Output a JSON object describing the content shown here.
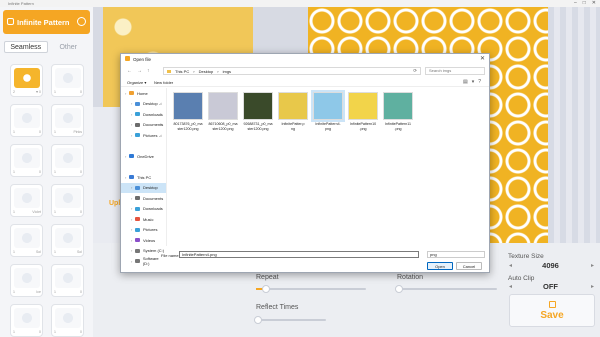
{
  "window": {
    "title": "Infinite Pattern",
    "controls": [
      "–",
      "□",
      "✕"
    ]
  },
  "app": {
    "name": "Infinite Pattern",
    "modes": [
      {
        "label": "Seamless",
        "active": true
      },
      {
        "label": "Other",
        "active": false
      }
    ],
    "upload_label": "Upl",
    "thumbnails": [
      {
        "left": "2",
        "right": "♥ 0",
        "selected": true
      },
      {
        "left": "1",
        "right": "0",
        "selected": false
      },
      {
        "left": "1",
        "right": "0",
        "selected": false
      },
      {
        "left": "1",
        "right": "Pinks",
        "selected": false
      },
      {
        "left": "1",
        "right": "0",
        "selected": false
      },
      {
        "left": "1",
        "right": "0",
        "selected": false
      },
      {
        "left": "1",
        "right": "Violet",
        "selected": false
      },
      {
        "left": "1",
        "right": "0",
        "selected": false
      },
      {
        "left": "1",
        "right": "Sol",
        "selected": false
      },
      {
        "left": "1",
        "right": "Sol",
        "selected": false
      },
      {
        "left": "1",
        "right": "Ice",
        "selected": false
      },
      {
        "left": "1",
        "right": "0",
        "selected": false
      },
      {
        "left": "1",
        "right": "0",
        "selected": false
      },
      {
        "left": "1",
        "right": "0",
        "selected": false
      }
    ],
    "controls": {
      "repeat_label": "Repeat",
      "rotation_label": "Rotation",
      "reflect_label": "Reflect Times"
    },
    "right": {
      "texture_size_label": "Texture Size",
      "texture_size_value": "4096",
      "auto_clip_label": "Auto Clip",
      "auto_clip_value": "OFF",
      "save_label": "Save"
    }
  },
  "dialog": {
    "title": "Open file",
    "close": "✕",
    "nav": [
      "←",
      "→",
      "↑",
      "⟳"
    ],
    "breadcrumb": [
      "This PC",
      "Desktop",
      "imgs"
    ],
    "refresh": "⟳",
    "search_placeholder": "Search imgs",
    "toolbar": {
      "organize": "Organize ▾",
      "new_folder": "New folder",
      "view": [
        "▤",
        "▾",
        "?"
      ]
    },
    "nav_items": [
      {
        "label": "Home",
        "indent": false,
        "pin": false,
        "color": "#f0a030"
      },
      {
        "label": "Desktop",
        "indent": true,
        "pin": true,
        "color": "#4a8fd8"
      },
      {
        "label": "Downloads",
        "indent": true,
        "pin": true,
        "color": "#3aa0d8"
      },
      {
        "label": "Documents",
        "indent": true,
        "pin": true,
        "color": "#6c6c6c"
      },
      {
        "label": "Pictures",
        "indent": true,
        "pin": true,
        "color": "#3aa0d8"
      },
      {
        "label": "",
        "indent": false,
        "pin": false,
        "color": "transparent"
      },
      {
        "label": "OneDrive",
        "indent": false,
        "pin": false,
        "color": "#2f7ad6"
      },
      {
        "label": "",
        "indent": false,
        "pin": false,
        "color": "transparent"
      },
      {
        "label": "This PC",
        "indent": false,
        "pin": false,
        "color": "#3a7bd5"
      },
      {
        "label": "Desktop",
        "indent": true,
        "pin": false,
        "color": "#4a8fd8",
        "selected": true
      },
      {
        "label": "Documents",
        "indent": true,
        "pin": false,
        "color": "#6c6c6c"
      },
      {
        "label": "Downloads",
        "indent": true,
        "pin": false,
        "color": "#3aa0d8"
      },
      {
        "label": "Music",
        "indent": true,
        "pin": false,
        "color": "#e5533d"
      },
      {
        "label": "Pictures",
        "indent": true,
        "pin": false,
        "color": "#3aa0d8"
      },
      {
        "label": "Videos",
        "indent": true,
        "pin": false,
        "color": "#8a4fc9"
      },
      {
        "label": "System (C:)",
        "indent": true,
        "pin": false,
        "color": "#777"
      },
      {
        "label": "Software (D:)",
        "indent": true,
        "pin": false,
        "color": "#777"
      }
    ],
    "files": [
      {
        "name": "80173876_p0_master1200.png",
        "line1": "80173876_p0_ma",
        "line2": "ster1200.png",
        "color": "#5a7fb0",
        "selected": false
      },
      {
        "name": "86710608_p0_master1200.png",
        "line1": "86710608_p0_ma",
        "line2": "ster1200.png",
        "color": "#c9c9d6",
        "selected": false
      },
      {
        "name": "92688731_p0_master1200.png",
        "line1": "92688731_p0_ma",
        "line2": "ster1200.png",
        "color": "#3a4a2a",
        "selected": false
      },
      {
        "name": "InfinitePattern.png",
        "line1": "InfinitePatter.p",
        "line2": "ng",
        "color": "#e8c84a",
        "selected": false
      },
      {
        "name": "InfinitePattern4.png",
        "line1": "InfinitePattern4.",
        "line2": "png",
        "color": "#8ec8e8",
        "selected": true
      },
      {
        "name": "InfinitePattern10.png",
        "line1": "InfinitePattern10",
        "line2": ".png",
        "color": "#f2d44a",
        "selected": false
      },
      {
        "name": "InfinitePattern11.png",
        "line1": "InfinitePattern11",
        "line2": ".png",
        "color": "#5fb0a0",
        "selected": false
      }
    ],
    "file_name_label": "File name:",
    "file_name_value": "InfinitePattern4.png",
    "file_type_value": "png",
    "open_label": "Open",
    "cancel_label": "Cancel"
  },
  "colors": {
    "accent": "#f5a623",
    "selection": "#cce4f7"
  }
}
